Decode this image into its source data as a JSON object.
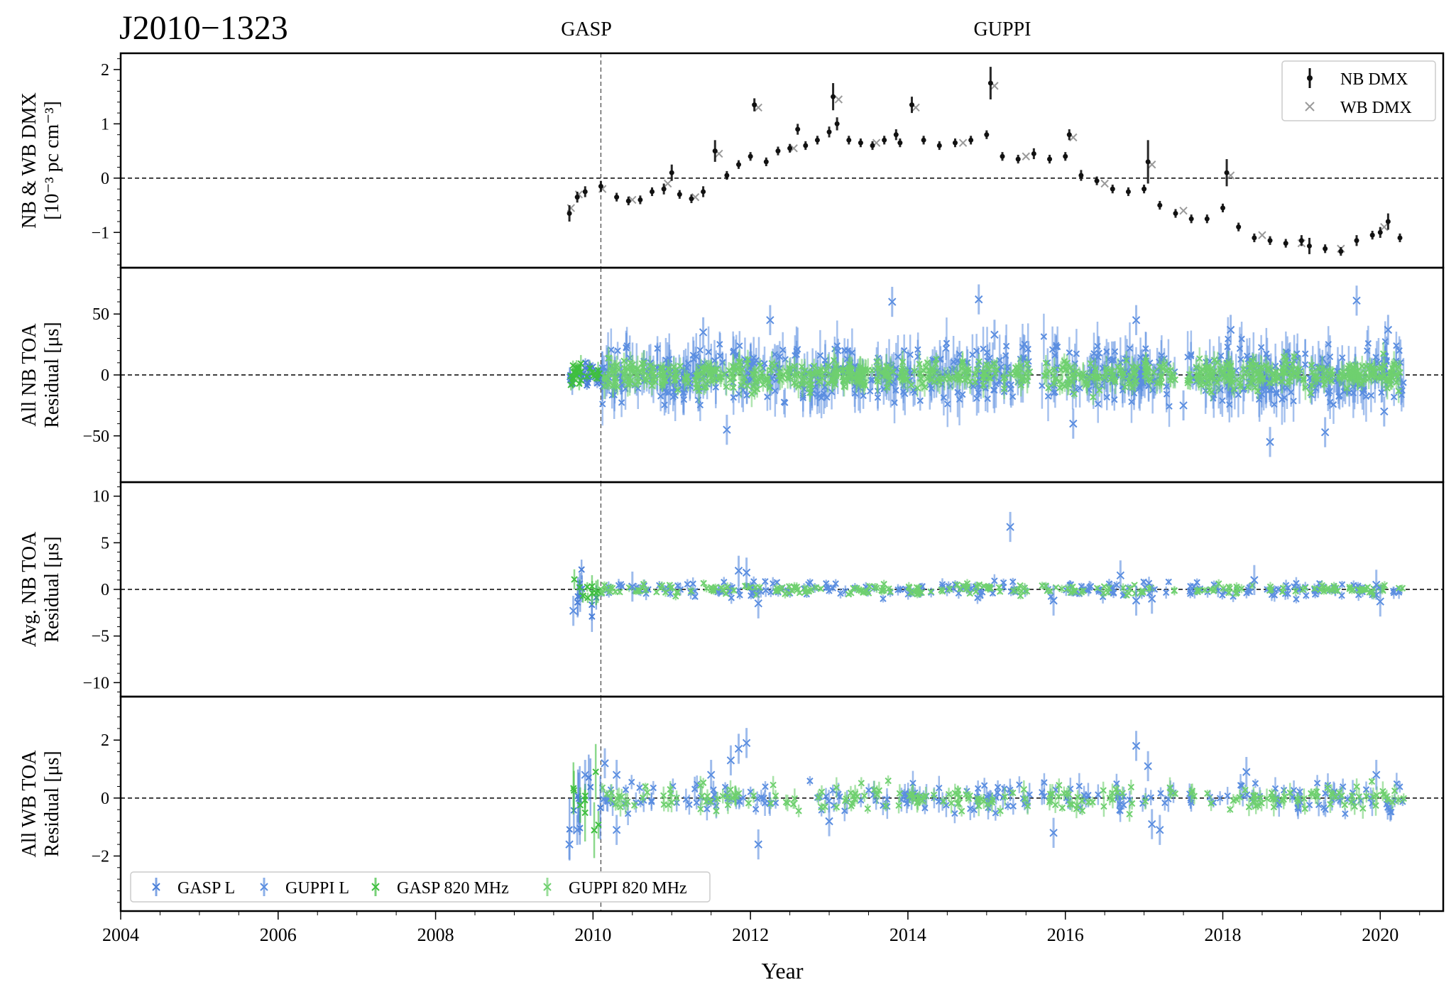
{
  "figure": {
    "title": "J2010−1323",
    "backend_labels": [
      "GASP",
      "GUPPI"
    ],
    "backend_switch_year": 2010.1
  },
  "colors": {
    "gasp_l": "#4a7fd8",
    "guppi_l": "#5b8ee0",
    "gasp_820": "#3fbf3f",
    "guppi_820": "#6fd06f",
    "nb_dmx": "#111111",
    "wb_dmx": "#9a9a9a"
  },
  "chart_data": [
    {
      "type": "scatter",
      "panel": "nb_wb_dmx",
      "ylabel_line1": "NB & WB DMX",
      "ylabel_line2": "[10⁻³ pc cm⁻³]",
      "ylim": [
        -1.65,
        2.3
      ],
      "yticks": [
        -1,
        0,
        1,
        2
      ],
      "legend": {
        "placement": "top-right",
        "entries": [
          "NB DMX",
          "WB DMX"
        ]
      },
      "series": [
        {
          "name": "NB DMX",
          "x": [
            2009.7,
            2009.8,
            2009.9,
            2010.1,
            2010.3,
            2010.45,
            2010.6,
            2010.75,
            2010.9,
            2011.0,
            2011.1,
            2011.25,
            2011.4,
            2011.55,
            2011.7,
            2011.85,
            2012.0,
            2012.05,
            2012.2,
            2012.35,
            2012.5,
            2012.6,
            2012.7,
            2012.85,
            2013.0,
            2013.05,
            2013.1,
            2013.25,
            2013.4,
            2013.55,
            2013.7,
            2013.85,
            2013.9,
            2014.05,
            2014.2,
            2014.4,
            2014.6,
            2014.8,
            2015.0,
            2015.05,
            2015.2,
            2015.4,
            2015.6,
            2015.8,
            2016.0,
            2016.05,
            2016.2,
            2016.4,
            2016.6,
            2016.8,
            2017.0,
            2017.05,
            2017.2,
            2017.4,
            2017.6,
            2017.8,
            2018.0,
            2018.05,
            2018.2,
            2018.4,
            2018.6,
            2018.8,
            2019.0,
            2019.1,
            2019.3,
            2019.5,
            2019.7,
            2019.9,
            2020.0,
            2020.1,
            2020.25
          ],
          "y": [
            -0.65,
            -0.35,
            -0.25,
            -0.15,
            -0.35,
            -0.42,
            -0.4,
            -0.25,
            -0.2,
            0.1,
            -0.3,
            -0.38,
            -0.25,
            0.5,
            0.05,
            0.25,
            0.4,
            1.35,
            0.3,
            0.5,
            0.55,
            0.9,
            0.6,
            0.7,
            0.85,
            1.5,
            1.0,
            0.7,
            0.65,
            0.6,
            0.7,
            0.8,
            0.65,
            1.35,
            0.7,
            0.6,
            0.65,
            0.7,
            0.8,
            1.75,
            0.4,
            0.35,
            0.45,
            0.35,
            0.4,
            0.8,
            0.05,
            -0.05,
            -0.2,
            -0.25,
            -0.2,
            0.3,
            -0.5,
            -0.65,
            -0.75,
            -0.75,
            -0.55,
            0.1,
            -0.9,
            -1.1,
            -1.15,
            -1.2,
            -1.15,
            -1.25,
            -1.3,
            -1.35,
            -1.15,
            -1.05,
            -1.0,
            -0.8,
            -1.1
          ],
          "yerr": [
            0.15,
            0.1,
            0.1,
            0.1,
            0.08,
            0.08,
            0.08,
            0.08,
            0.1,
            0.15,
            0.08,
            0.08,
            0.1,
            0.2,
            0.08,
            0.08,
            0.08,
            0.12,
            0.08,
            0.08,
            0.08,
            0.1,
            0.08,
            0.08,
            0.1,
            0.25,
            0.12,
            0.08,
            0.08,
            0.08,
            0.08,
            0.1,
            0.08,
            0.15,
            0.08,
            0.08,
            0.08,
            0.08,
            0.08,
            0.3,
            0.08,
            0.08,
            0.1,
            0.08,
            0.08,
            0.1,
            0.1,
            0.08,
            0.08,
            0.08,
            0.08,
            0.4,
            0.08,
            0.08,
            0.08,
            0.08,
            0.08,
            0.25,
            0.08,
            0.08,
            0.08,
            0.08,
            0.1,
            0.15,
            0.08,
            0.08,
            0.1,
            0.08,
            0.1,
            0.15,
            0.08
          ]
        },
        {
          "name": "WB DMX",
          "x": [
            2009.72,
            2009.82,
            2010.12,
            2010.5,
            2010.95,
            2011.3,
            2011.6,
            2012.1,
            2012.55,
            2013.12,
            2013.6,
            2014.1,
            2014.7,
            2015.1,
            2015.5,
            2016.1,
            2016.5,
            2017.1,
            2017.5,
            2018.1,
            2018.5,
            2019.0,
            2019.5,
            2020.05
          ],
          "y": [
            -0.55,
            -0.3,
            -0.2,
            -0.4,
            -0.1,
            -0.35,
            0.45,
            1.3,
            0.55,
            1.45,
            0.65,
            1.3,
            0.65,
            1.7,
            0.4,
            0.75,
            -0.1,
            0.25,
            -0.6,
            0.05,
            -1.05,
            -1.2,
            -1.3,
            -0.9
          ]
        }
      ]
    },
    {
      "type": "scatter",
      "panel": "all_nb_toa",
      "ylabel_line1": "All NB TOA",
      "ylabel_line2": "Residual [μs]",
      "ylim": [
        -88,
        88
      ],
      "yticks": [
        -50,
        0,
        50
      ],
      "series": [
        {
          "name": "GASP L",
          "x_range": [
            2009.7,
            2010.1
          ],
          "scatter": 5
        },
        {
          "name": "GUPPI L",
          "x_range": [
            2010.1,
            2020.3
          ],
          "scatter": 12
        },
        {
          "name": "GASP 820 MHz",
          "x_range": [
            2009.7,
            2010.1
          ],
          "scatter": 4
        },
        {
          "name": "GUPPI 820 MHz",
          "x_range": [
            2010.1,
            2020.3
          ],
          "scatter": 6
        }
      ],
      "outliers": [
        [
          2011.4,
          35
        ],
        [
          2011.7,
          -45
        ],
        [
          2012.25,
          45
        ],
        [
          2013.8,
          60
        ],
        [
          2014.9,
          62
        ],
        [
          2015.1,
          33
        ],
        [
          2016.1,
          -40
        ],
        [
          2016.9,
          45
        ],
        [
          2017.5,
          -25
        ],
        [
          2018.1,
          37
        ],
        [
          2018.6,
          -55
        ],
        [
          2019.3,
          -47
        ],
        [
          2019.7,
          61
        ],
        [
          2020.05,
          -30
        ],
        [
          2020.1,
          37
        ]
      ]
    },
    {
      "type": "scatter",
      "panel": "avg_nb_toa",
      "ylabel_line1": "Avg. NB TOA",
      "ylabel_line2": "Residual [μs]",
      "ylim": [
        -11.5,
        11.5
      ],
      "yticks": [
        -10,
        -5,
        0,
        5,
        10
      ],
      "series": [
        {
          "name": "GASP L",
          "x_range": [
            2009.7,
            2010.1
          ],
          "scatter": 1.2
        },
        {
          "name": "GUPPI L",
          "x_range": [
            2010.1,
            2020.3
          ],
          "scatter": 0.4
        },
        {
          "name": "GASP 820 MHz",
          "x_range": [
            2009.7,
            2010.1
          ],
          "scatter": 0.8
        },
        {
          "name": "GUPPI 820 MHz",
          "x_range": [
            2010.1,
            2020.3
          ],
          "scatter": 0.3
        }
      ],
      "outliers": [
        [
          2009.75,
          -2.3
        ],
        [
          2010.5,
          0.3
        ],
        [
          2011.85,
          2.0
        ],
        [
          2011.95,
          1.8
        ],
        [
          2012.1,
          -1.5
        ],
        [
          2015.3,
          6.7
        ],
        [
          2015.85,
          -1.2
        ],
        [
          2016.7,
          1.5
        ],
        [
          2016.9,
          -1.2
        ],
        [
          2017.1,
          -1.0
        ],
        [
          2018.4,
          1.0
        ],
        [
          2019.95,
          0.5
        ],
        [
          2020.0,
          -1.3
        ]
      ]
    },
    {
      "type": "scatter",
      "panel": "all_wb_toa",
      "ylabel_line1": "All WB TOA",
      "ylabel_line2": "Residual [μs]",
      "ylim": [
        -3.9,
        3.5
      ],
      "yticks": [
        -2,
        0,
        2
      ],
      "legend": {
        "placement": "bottom-left",
        "entries": [
          "GASP L",
          "GUPPI L",
          "GASP 820 MHz",
          "GUPPI 820 MHz"
        ]
      },
      "series": [
        {
          "name": "GASP L",
          "x_range": [
            2009.7,
            2010.1
          ],
          "scatter": 0.8
        },
        {
          "name": "GUPPI L",
          "x_range": [
            2010.1,
            2020.3
          ],
          "scatter": 0.25
        },
        {
          "name": "GASP 820 MHz",
          "x_range": [
            2009.7,
            2010.1
          ],
          "scatter": 0.6
        },
        {
          "name": "GUPPI 820 MHz",
          "x_range": [
            2010.1,
            2020.3
          ],
          "scatter": 0.2
        }
      ],
      "outliers": [
        [
          2009.7,
          -1.6
        ],
        [
          2009.8,
          -1.1
        ],
        [
          2009.9,
          0.8
        ],
        [
          2010.15,
          1.2
        ],
        [
          2010.3,
          0.8
        ],
        [
          2010.3,
          -1.1
        ],
        [
          2011.5,
          0.8
        ],
        [
          2011.75,
          1.3
        ],
        [
          2011.85,
          1.7
        ],
        [
          2011.95,
          1.9
        ],
        [
          2012.1,
          -1.6
        ],
        [
          2013.0,
          -0.8
        ],
        [
          2015.85,
          -1.2
        ],
        [
          2016.9,
          1.8
        ],
        [
          2017.05,
          1.1
        ],
        [
          2017.1,
          -0.9
        ],
        [
          2017.2,
          -1.1
        ],
        [
          2018.3,
          0.9
        ],
        [
          2019.95,
          0.8
        ]
      ]
    }
  ],
  "xaxis": {
    "label": "Year",
    "xlim": [
      2004,
      2020.8
    ],
    "ticks": [
      2004,
      2006,
      2008,
      2010,
      2012,
      2014,
      2016,
      2018,
      2020
    ]
  }
}
